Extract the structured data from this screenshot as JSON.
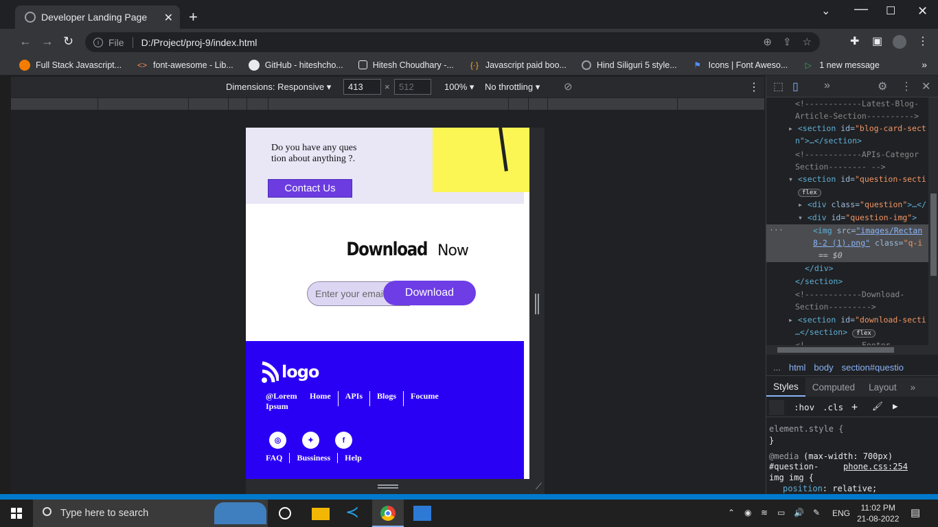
{
  "browser": {
    "tab_title": "Developer Landing Page",
    "address_prefix": "File",
    "url": "D:/Project/proj-9/index.html"
  },
  "bookmarks": [
    {
      "label": "Full Stack Javascript...",
      "icon": "orange-circle-icon"
    },
    {
      "label": "font-awesome - Lib...",
      "icon": "code-icon"
    },
    {
      "label": "GitHub - hiteshcho...",
      "icon": "github-icon"
    },
    {
      "label": "Hitesh Choudhary -...",
      "icon": "checkbox-icon"
    },
    {
      "label": "Javascript paid boo...",
      "icon": "braces-icon"
    },
    {
      "label": "Hind Siliguri 5 style...",
      "icon": "globe-icon"
    },
    {
      "label": "Icons | Font Aweso...",
      "icon": "flag-icon"
    },
    {
      "label": "1 new message",
      "icon": "message-icon"
    }
  ],
  "device_toolbar": {
    "dimensions": "Dimensions: Responsive",
    "width": "413",
    "times": "×",
    "height": "512",
    "zoom": "100%",
    "throttling": "No throttling"
  },
  "page": {
    "question_text": "Do you have any ques tion about anything ?.",
    "contact_button": "Contact Us",
    "download_bold": "Download",
    "download_normal": "Now",
    "email_placeholder": "Enter your email",
    "download_button": "Download",
    "logo_text": "logo",
    "footer_nav": [
      "@Lorem Ipsum",
      "Home",
      "APIs",
      "Blogs",
      "Focume"
    ],
    "footer_links": [
      "FAQ",
      "Bussiness",
      "Help"
    ],
    "socials": [
      "instagram-icon",
      "twitter-icon",
      "facebook-icon"
    ]
  },
  "devtools": {
    "crumbs": [
      "...",
      "html",
      "body",
      "section#questio"
    ],
    "tabs": [
      "Styles",
      "Computed",
      "Layout",
      "»"
    ],
    "filter": {
      "hov": ":hov",
      "cls": ".cls"
    },
    "dom": {
      "c1": "<!------------Latest-Blog-",
      "c1b": "Article-Section---------->",
      "s1_tag": "<section",
      "s1_attr": "id=",
      "s1_val": "\"blog-card-sect",
      "s1_rest": "n\">…</section>",
      "c2": "<!------------APIs-Categor",
      "c2b": "Section-------- -->",
      "s2_tag": "<section",
      "s2_attr": "id=",
      "s2_val": "\"question-secti",
      "flex1": "flex",
      "div1_tag": "<div",
      "div1_attr": "class=",
      "div1_val": "\"question\"",
      "div1_rest": ">…</",
      "div2_tag": "<div",
      "div2_attr": "id=",
      "div2_val": "\"question-img\"",
      "div2_end": ">",
      "img_tag": "<img",
      "img_attr": "src=",
      "img_val": "\"images/Rectan",
      "img_val2": "8-2 (1).png\"",
      "img_attr2": "class=",
      "img_val3": "\"q-i",
      "img_eq": "== $0",
      "div_close": "</div>",
      "sec_close": "</section>",
      "c3": "<!------------Download-",
      "c3b": "Section--------->",
      "s3_tag": "<section",
      "s3_attr": "id=",
      "s3_val": "\"download-secti",
      "s3_rest": "…</section>",
      "flex2": "flex",
      "c4": "<!------------Footer-"
    },
    "styles": {
      "element_style": "element.style {",
      "close": "}",
      "media": "@media",
      "media_rule": "(max-width: 700px)",
      "selector1": "#question-",
      "source": "phone.css:254",
      "selector2": "img img {",
      "prop": "position",
      "prop_val": "relative;"
    }
  },
  "taskbar": {
    "search_placeholder": "Type here to search",
    "lang": "ENG",
    "time": "11:02 PM",
    "date": "21-08-2022"
  },
  "colors": {
    "purple": "#6c3ce0",
    "footer_blue": "#2a00f5",
    "light_lavender": "#e9e6f6",
    "yellow": "#fbf654"
  }
}
